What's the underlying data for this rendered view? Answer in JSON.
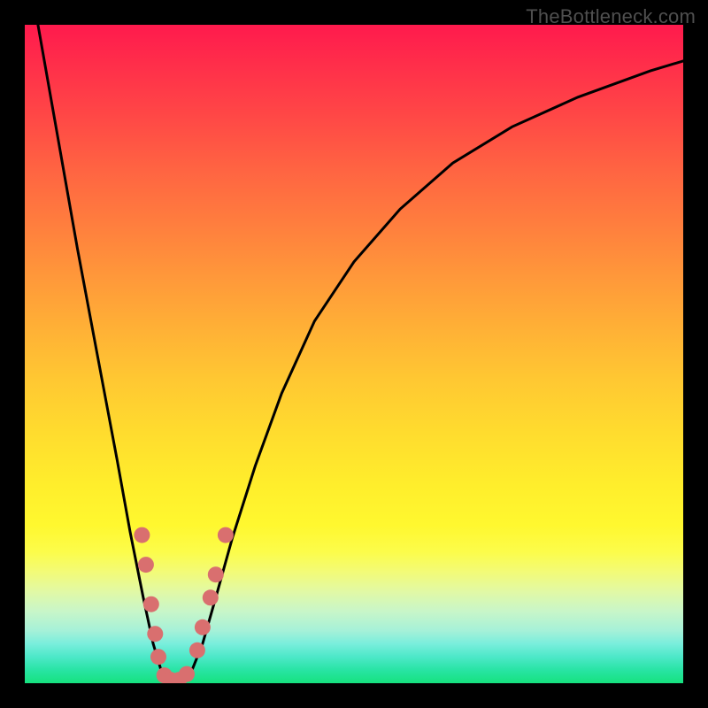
{
  "watermark": "TheBottleneck.com",
  "colors": {
    "frame": "#000000",
    "curve": "#000000",
    "marker_fill": "#d96f6f",
    "marker_stroke": "#a44f4f"
  },
  "chart_data": {
    "type": "line",
    "title": "",
    "xlabel": "",
    "ylabel": "",
    "xlim": [
      0,
      100
    ],
    "ylim": [
      0,
      100
    ],
    "grid": false,
    "note": "Axis values are not labeled in the image; x/y positions below are in plot-box percent (0=left/bottom, 100=right/top).",
    "series": [
      {
        "name": "bottleneck-curve",
        "x": [
          2,
          5,
          8,
          11,
          14,
          16,
          18,
          19.5,
          21,
          22,
          23,
          24,
          25,
          27,
          29,
          31.5,
          35,
          39,
          44,
          50,
          57,
          65,
          74,
          84,
          95,
          100
        ],
        "y": [
          100,
          83,
          66,
          50,
          34,
          23,
          13,
          6,
          1,
          0,
          0,
          0,
          1,
          6,
          13,
          22,
          33,
          44,
          55,
          64,
          72,
          79,
          84.5,
          89,
          93,
          94.5
        ]
      }
    ],
    "markers": {
      "name": "highlighted-points",
      "points": [
        {
          "x": 17.8,
          "y": 22.5
        },
        {
          "x": 18.4,
          "y": 18.0
        },
        {
          "x": 19.2,
          "y": 12.0
        },
        {
          "x": 19.8,
          "y": 7.5
        },
        {
          "x": 20.3,
          "y": 4.0
        },
        {
          "x": 21.2,
          "y": 1.2
        },
        {
          "x": 22.2,
          "y": 0.5
        },
        {
          "x": 23.4,
          "y": 0.5
        },
        {
          "x": 24.6,
          "y": 1.4
        },
        {
          "x": 26.2,
          "y": 5.0
        },
        {
          "x": 27.0,
          "y": 8.5
        },
        {
          "x": 28.2,
          "y": 13.0
        },
        {
          "x": 29.0,
          "y": 16.5
        },
        {
          "x": 30.5,
          "y": 22.5
        }
      ]
    }
  }
}
